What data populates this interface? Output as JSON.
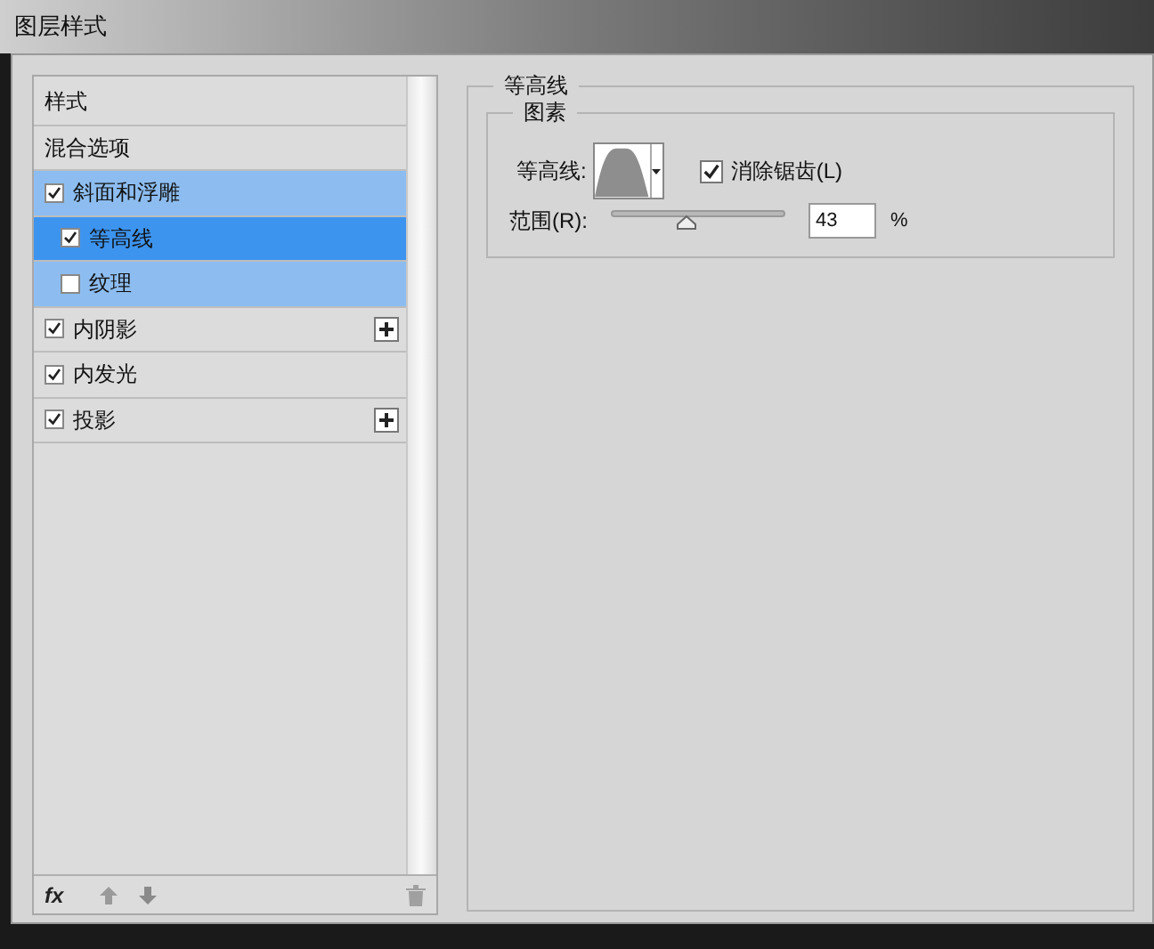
{
  "window": {
    "title": "图层样式"
  },
  "styles_list": {
    "items": [
      {
        "kind": "header",
        "label": "样式",
        "selected": false
      },
      {
        "kind": "header",
        "label": "混合选项",
        "selected": false
      },
      {
        "kind": "effect",
        "label": "斜面和浮雕",
        "checked": true,
        "selected": false,
        "add_button": false,
        "children": [
          {
            "kind": "effect",
            "label": "等高线",
            "checked": true,
            "selected": true,
            "add_button": false
          },
          {
            "kind": "effect",
            "label": "纹理",
            "checked": false,
            "selected": false,
            "add_button": false
          }
        ]
      },
      {
        "kind": "effect",
        "label": "内阴影",
        "checked": true,
        "selected": false,
        "add_button": true
      },
      {
        "kind": "effect",
        "label": "内发光",
        "checked": true,
        "selected": false,
        "add_button": false
      },
      {
        "kind": "effect",
        "label": "投影",
        "checked": true,
        "selected": false,
        "add_button": true
      }
    ],
    "fx_label": "fx"
  },
  "panel": {
    "title": "等高线",
    "group": {
      "title": "图素",
      "contour_label": "等高线:",
      "anti_alias": {
        "label": "消除锯齿(L)",
        "checked": true
      },
      "range": {
        "label": "范围(R):",
        "level": 0.43,
        "value": "43",
        "unit": "%"
      }
    }
  }
}
